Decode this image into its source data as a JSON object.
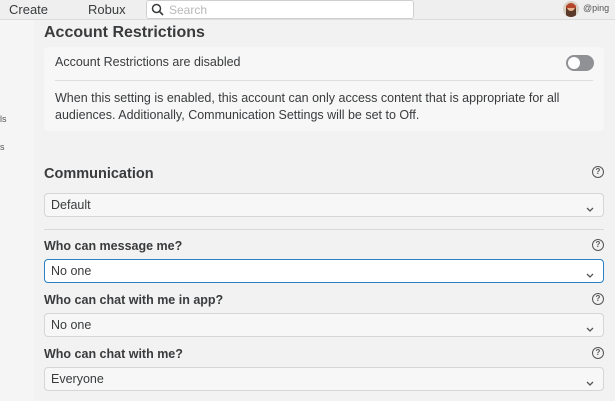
{
  "topbar": {
    "create_label": "Create",
    "robux_label": "Robux",
    "search_placeholder": "Search",
    "username": "@ping"
  },
  "sidebar": {
    "items": [
      "ls",
      "s"
    ]
  },
  "account_restrictions": {
    "title": "Account Restrictions",
    "status_label": "Account Restrictions are disabled",
    "enabled": false,
    "description": "When this setting is enabled, this account can only access content that is appropriate for all audiences. Additionally, Communication Settings will be set to Off."
  },
  "communication": {
    "title": "Communication",
    "help_glyph": "?",
    "preset_value": "Default",
    "fields": [
      {
        "label": "Who can message me?",
        "value": "No one"
      },
      {
        "label": "Who can chat with me in app?",
        "value": "No one"
      },
      {
        "label": "Who can chat with me?",
        "value": "Everyone"
      }
    ]
  },
  "colors": {
    "focus_border": "#2a81c7",
    "toggle_off": "#8f9194"
  }
}
